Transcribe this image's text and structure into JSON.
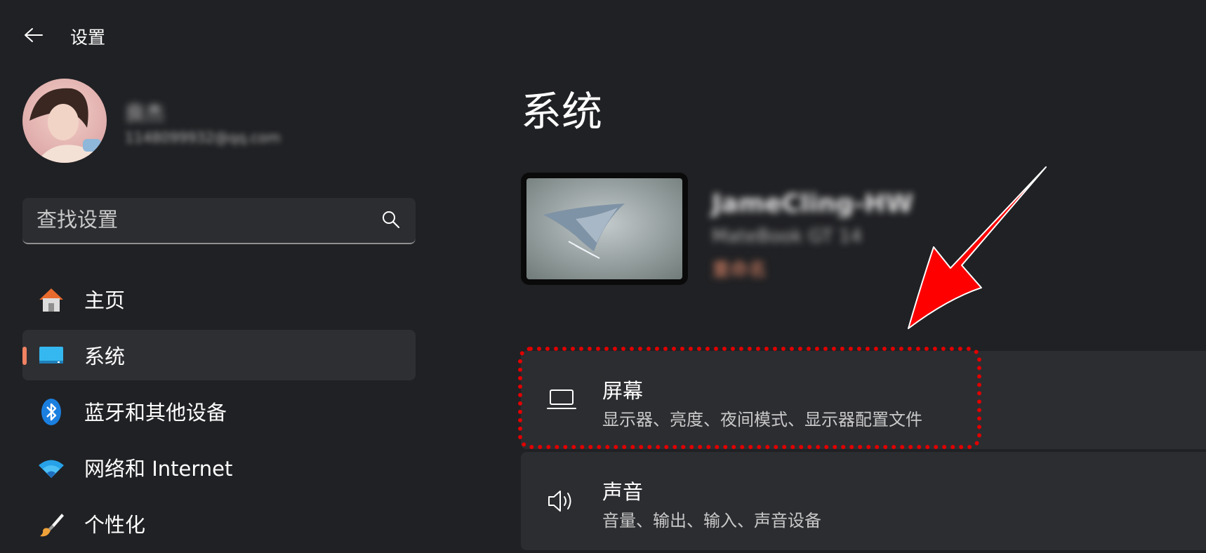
{
  "app": {
    "title": "设置"
  },
  "profile": {
    "name": "良杰",
    "email": "1148099932@qq.com"
  },
  "search": {
    "placeholder": "查找设置"
  },
  "sidebar": {
    "items": [
      {
        "label": "主页",
        "icon": "home-icon",
        "active": false
      },
      {
        "label": "系统",
        "icon": "system-icon",
        "active": true
      },
      {
        "label": "蓝牙和其他设备",
        "icon": "bluetooth-icon",
        "active": false
      },
      {
        "label": "网络和 Internet",
        "icon": "wifi-icon",
        "active": false
      },
      {
        "label": "个性化",
        "icon": "brush-icon",
        "active": false
      }
    ]
  },
  "main": {
    "title": "系统",
    "device": {
      "name": "JameCling-HW",
      "model": "MateBook GT 14",
      "rename_label": "重命名"
    },
    "cards": [
      {
        "title": "屏幕",
        "subtitle": "显示器、亮度、夜间模式、显示器配置文件",
        "icon": "display-icon"
      },
      {
        "title": "声音",
        "subtitle": "音量、输出、输入、声音设备",
        "icon": "speaker-icon"
      }
    ]
  },
  "colors": {
    "background": "#202124",
    "card": "#2c2d31",
    "accent": "#f18262",
    "annotation": "#e00000"
  }
}
